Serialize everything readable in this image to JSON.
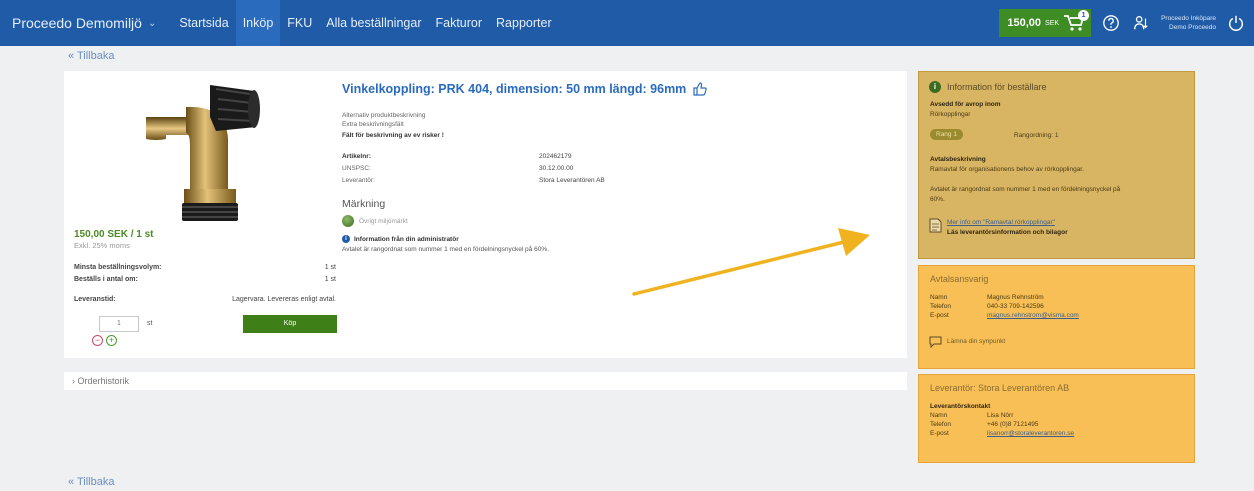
{
  "topbar": {
    "brand": "Proceedo Demomiljö",
    "nav": [
      "Startsida",
      "Inköp",
      "FKU",
      "Alla beställningar",
      "Fakturor",
      "Rapporter"
    ],
    "active_nav": "Inköp",
    "cart_amount": "150,00",
    "cart_currency": "SEK",
    "cart_count": "1",
    "user_line1": "Proceedo Inköpare",
    "user_line2": "Demo Proceedo",
    "bar_color": "#1f5ba6"
  },
  "back_label": "Tillbaka",
  "product": {
    "title": "Vinkelkoppling: PRK 404, dimension: 50 mm längd: 96mm",
    "desc1": "Alternativ produktbeskrivning",
    "desc2": "Extra beskrivningsfält",
    "desc3": "Fält för beskrivning av ev risker !",
    "price": "150,00 SEK / 1 st",
    "vat": "Exkl. 25% moms",
    "min_order_label": "Minsta beställningsvolym:",
    "min_order_value": "1 st",
    "order_multiple_label": "Beställs i antal om:",
    "order_multiple_value": "1 st",
    "delivery_label": "Leveranstid:",
    "delivery_value": "Lagervara. Levereras enligt avtal.",
    "qty_value": "1",
    "qty_unit": "st",
    "buy_label": "Köp",
    "attributes": [
      {
        "k": "Artikelnr:",
        "v": "202462179"
      },
      {
        "k": "UNSPSC:",
        "v": "30.12.00.00"
      },
      {
        "k": "Leverantör:",
        "v": "Stora Leverantören AB"
      }
    ],
    "marking_title": "Märkning",
    "eco_label": "Övrigt miljömärkt",
    "admin_info_title": "Information från din administratör",
    "admin_info_text": "Avtalet är rangordnat som nummer 1 med en fördelningsnyckel på 60%."
  },
  "order_history_label": "Orderhistorik",
  "panel_buyer": {
    "title": "Information för beställare",
    "agreement_label": "Avsedd för avrop inom",
    "agreement_value": "Rörkopplingar",
    "rank_pill": "Rang 1",
    "ranking_label": "Rangordning: 1",
    "desc_label": "Avtalsbeskrivning",
    "desc_text": "Ramavtal för organisationens behov av rörkopplingar.",
    "rank_text_1": "Avtalet är rangordnat som nummer 1 med en fördelningsnyckel på",
    "rank_text_2": "60%.",
    "more_info": "Mer info om \"Ramavtal rörkopplingar\"",
    "more_info_sub": "Läs leverantörsinformation och bilagor"
  },
  "panel_responsible": {
    "title": "Avtalsansvarig",
    "rows": [
      {
        "k": "Namn",
        "v": "Magnus Rehnström"
      },
      {
        "k": "Telefon",
        "v": "040-33 709-142596"
      },
      {
        "k": "E-post",
        "v": "magnus.rehnstrom@visma.com"
      }
    ],
    "feedback": "Lämna din synpunkt"
  },
  "panel_supplier": {
    "title": "Leverantör: Stora Leverantören AB",
    "contact_label": "Leverantörskontakt",
    "rows": [
      {
        "k": "Namn",
        "v": "Lisa Nörr"
      },
      {
        "k": "Telefon",
        "v": "+46 (0)8 7121495"
      },
      {
        "k": "E-post",
        "v": "lisanorr@storaleverantoren.se"
      }
    ]
  },
  "colors": {
    "accent": "#1f5ba6",
    "buy_green": "#3f7f18",
    "panel_orange": "#f7bf55",
    "arrow": "#f0b21f"
  }
}
